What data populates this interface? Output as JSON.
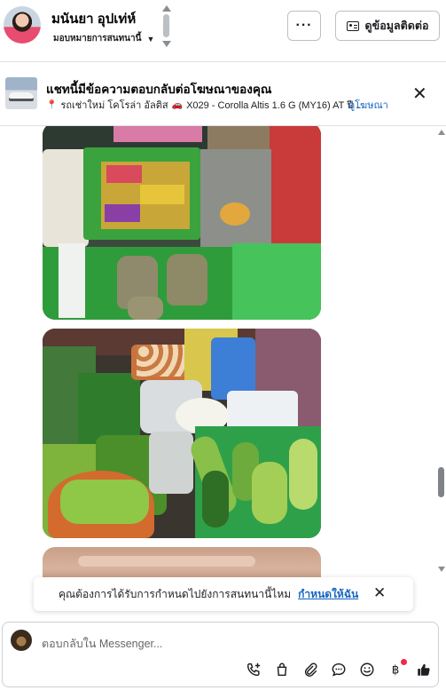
{
  "header": {
    "contact_name": "มนันยา อุปเท่ห์",
    "assign_label": "มอบหมายการสนทนานี้",
    "more_label": "···",
    "contact_info_label": "ดูข้อมูลติดต่อ"
  },
  "ad_banner": {
    "title": "แชทนี้มีข้อความตอบกลับต่อโฆษณาของคุณ",
    "location_text": "รถเช่าใหม่ โคโรล่า อัลติส",
    "car_text": "X029 - Corolla Altis 1.6 G (MY16) AT ปี ...",
    "link_label": "ดูโฆษณา"
  },
  "prompt": {
    "text": "คุณต้องการได้รับการกำหนดไปยังการสนทนานี้ไหม",
    "link_label": "กำหนดให้ฉัน"
  },
  "composer": {
    "placeholder": "ตอบกลับใน Messenger..."
  },
  "icons": {
    "tools": [
      "phone-plus-icon",
      "shopping-bag-icon",
      "paperclip-icon",
      "chat-bubble-icon",
      "emoji-icon",
      "baht-icon",
      "thumbs-up-icon"
    ]
  },
  "colors": {
    "link": "#1565c0",
    "badge": "#f02849",
    "border": "#dcdfe3"
  }
}
